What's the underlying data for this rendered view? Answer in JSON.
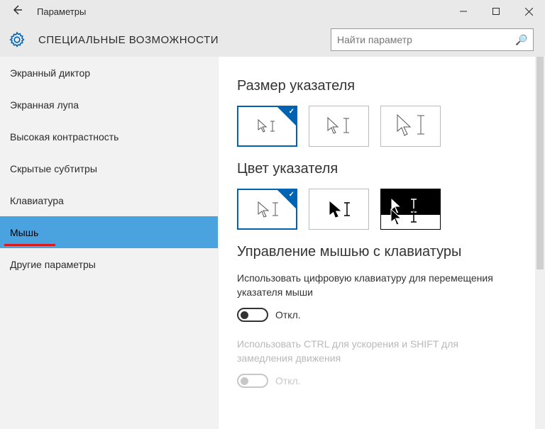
{
  "window": {
    "title": "Параметры"
  },
  "header": {
    "title": "СПЕЦИАЛЬНЫЕ ВОЗМОЖНОСТИ",
    "search_placeholder": "Найти параметр"
  },
  "sidebar": {
    "items": [
      {
        "label": "Экранный диктор"
      },
      {
        "label": "Экранная лупа"
      },
      {
        "label": "Высокая контрастность"
      },
      {
        "label": "Скрытые субтитры"
      },
      {
        "label": "Клавиатура"
      },
      {
        "label": "Мышь"
      },
      {
        "label": "Другие параметры"
      }
    ],
    "selected": 5
  },
  "content": {
    "pointer_size_heading": "Размер указателя",
    "pointer_color_heading": "Цвет указателя",
    "mouse_keys_heading": "Управление мышью с клавиатуры",
    "mouse_keys_desc": "Использовать цифровую клавиатуру для перемещения указателя мыши",
    "toggle_off_label": "Откл.",
    "ctrl_shift_desc": "Использовать CTRL для ускорения и SHIFT для замедления движения",
    "pointer_size": {
      "options": [
        "small",
        "medium",
        "large"
      ],
      "selected": 0
    },
    "pointer_color": {
      "options": [
        "white",
        "black",
        "inverted"
      ],
      "selected": 0
    },
    "mouse_keys_enabled": false,
    "ctrl_shift_enabled": false
  },
  "colors": {
    "accent": "#0063B1"
  }
}
